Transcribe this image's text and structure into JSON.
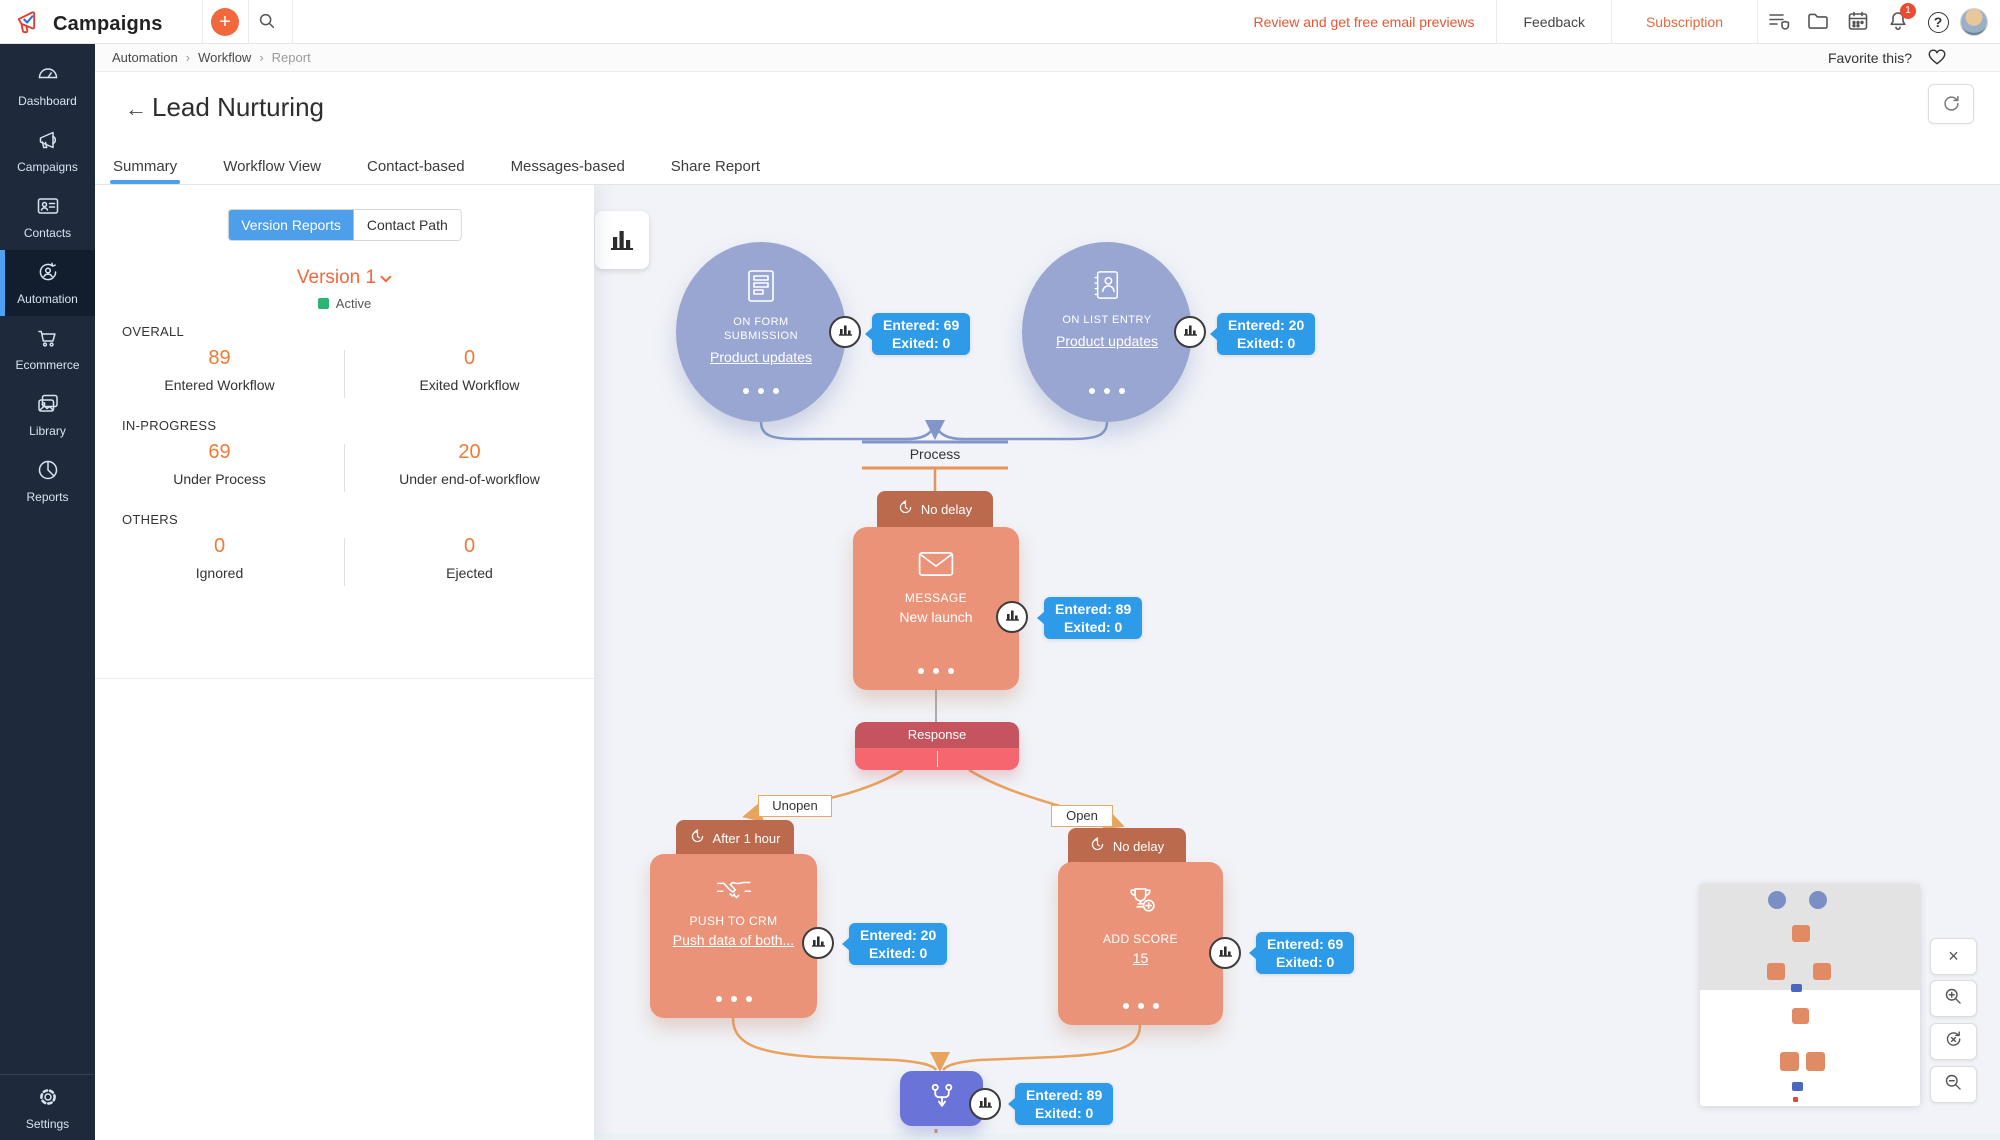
{
  "colors": {
    "accent_blue": "#4C9FE8",
    "stat_orange": "#EE7B34",
    "version_orange": "#F0683C",
    "brand_plus_orange": "#F0683C",
    "node_salmon": "#EB9379",
    "delay_terracotta": "#BC6A4E",
    "response_dark": "#C5545E",
    "response_light": "#F5666F",
    "entry_circle_blue": "#98A6D1",
    "merge_purple": "#6A73D8",
    "tooltip_blue": "#2D9BE8",
    "sidebar_navy": "#1E2A3B",
    "status_green": "#2BB573",
    "notification_red": "#E94B35"
  },
  "icons": {
    "back_arrow": "←",
    "breadcrumb_sep": "›",
    "close": "×",
    "help": "?"
  },
  "topbar": {
    "app_name": "Campaigns",
    "review_link": "Review and get free email previews",
    "feedback": "Feedback",
    "subscription": "Subscription",
    "notification_count": "1"
  },
  "breadcrumb": {
    "item1": "Automation",
    "item2": "Workflow",
    "item3": "Report",
    "favorite_label": "Favorite this?"
  },
  "page": {
    "title": "Lead Nurturing"
  },
  "tabs": {
    "summary": "Summary",
    "workflow_view": "Workflow View",
    "contact_based": "Contact-based",
    "messages_based": "Messages-based",
    "share_report": "Share Report"
  },
  "sidebar": {
    "dashboard": "Dashboard",
    "campaigns": "Campaigns",
    "contacts": "Contacts",
    "automation": "Automation",
    "ecommerce": "Ecommerce",
    "library": "Library",
    "reports": "Reports",
    "settings": "Settings"
  },
  "panel": {
    "toggle": {
      "version_reports": "Version Reports",
      "contact_path": "Contact Path"
    },
    "version_label": "Version 1",
    "version_status": "Active",
    "overall": {
      "title": "OVERALL",
      "stat1_value": "89",
      "stat1_label": "Entered Workflow",
      "stat2_value": "0",
      "stat2_label": "Exited Workflow"
    },
    "in_progress": {
      "title": "IN-PROGRESS",
      "stat1_value": "69",
      "stat1_label": "Under Process",
      "stat2_value": "20",
      "stat2_label": "Under end-of-workflow"
    },
    "others": {
      "title": "OTHERS",
      "stat1_value": "0",
      "stat1_label": "Ignored",
      "stat2_value": "0",
      "stat2_label": "Ejected"
    }
  },
  "workflow": {
    "process_label": "Process",
    "no_delay": "No delay",
    "after_1_hour": "After 1 hour",
    "response": "Response",
    "unopen": "Unopen",
    "open": "Open",
    "form_submission": {
      "type": "ON FORM SUBMISSION",
      "name": "Product updates",
      "entered": "Entered: 69",
      "exited": "Exited: 0"
    },
    "list_entry": {
      "type": "ON LIST ENTRY",
      "name": "Product updates",
      "entered": "Entered: 20",
      "exited": "Exited: 0"
    },
    "message": {
      "type": "MESSAGE",
      "name": "New launch",
      "entered": "Entered: 89",
      "exited": "Exited: 0"
    },
    "push_to_crm": {
      "type": "PUSH TO CRM",
      "name": "Push data of both...",
      "entered": "Entered: 20",
      "exited": "Exited: 0"
    },
    "add_score": {
      "type": "ADD SCORE",
      "name": "15",
      "entered": "Entered: 69",
      "exited": "Exited: 0"
    },
    "merge": {
      "entered": "Entered: 89",
      "exited": "Exited: 0"
    }
  }
}
